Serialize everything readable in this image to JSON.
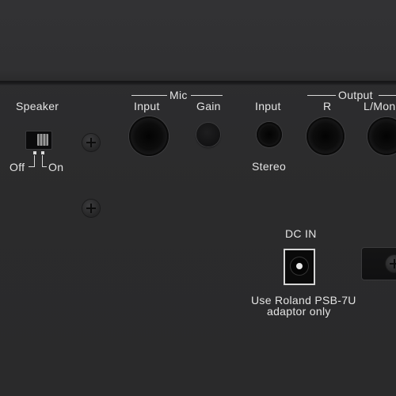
{
  "panel": {
    "speaker": {
      "title": "Speaker",
      "off_label": "Off",
      "on_label": "On"
    },
    "mic": {
      "group_label": "Mic",
      "input_label": "Input",
      "gain_label": "Gain"
    },
    "stereo_input": {
      "input_label": "Input",
      "type_label": "Stereo"
    },
    "output": {
      "group_label": "Output",
      "r_label": "R",
      "l_label": "L/Mono"
    },
    "dc_in": {
      "label": "DC IN",
      "note_line1": "Use Roland PSB-7U",
      "note_line2": "adaptor only"
    }
  },
  "colors": {
    "panel": "#2c2c2d",
    "print": "#e4e4e4",
    "jack": "#0a0a0a"
  }
}
